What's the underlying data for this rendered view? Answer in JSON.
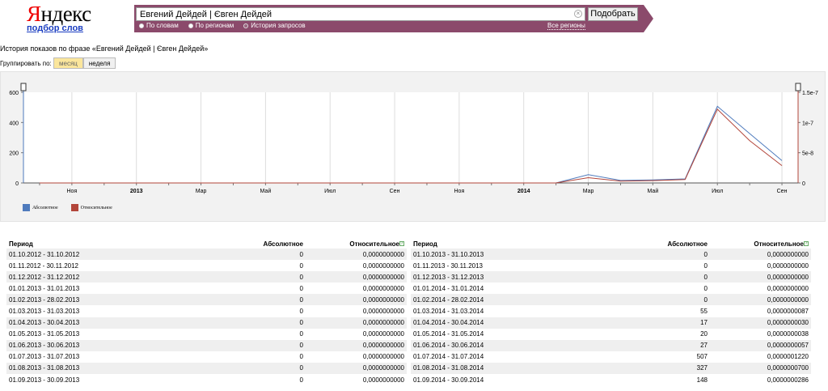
{
  "header": {
    "logo_first": "Я",
    "logo_rest": "ндекс",
    "sublink": "подбор слов",
    "query": "Евгений Дейдей | Євген Дейдей",
    "submit": "Подобрать",
    "radios": [
      {
        "label": "По словам",
        "checked": false
      },
      {
        "label": "По регионам",
        "checked": false
      },
      {
        "label": "История запросов",
        "checked": true
      }
    ],
    "regions": "Все регионы"
  },
  "page": {
    "title": "История показов по фразе «Евгений Дейдей | Євген Дейдей»",
    "group_label": "Группировать по:",
    "group_tabs": [
      {
        "label": "месяц",
        "active": true
      },
      {
        "label": "неделя",
        "active": false
      }
    ]
  },
  "colors": {
    "absolute": "#4f7bbd",
    "relative": "#b2453a",
    "header": "#8b4a6b"
  },
  "chart_data": {
    "type": "line",
    "x": [
      "10.2012",
      "11.2012",
      "12.2012",
      "01.2013",
      "02.2013",
      "03.2013",
      "04.2013",
      "05.2013",
      "06.2013",
      "07.2013",
      "08.2013",
      "09.2013",
      "10.2013",
      "11.2013",
      "12.2013",
      "01.2014",
      "02.2014",
      "03.2014",
      "04.2014",
      "05.2014",
      "06.2014",
      "07.2014",
      "08.2014",
      "09.2014"
    ],
    "x_tick_labels": [
      "Ноя",
      "2013",
      "Мар",
      "Май",
      "Июл",
      "Сен",
      "Ноя",
      "2014",
      "Мар",
      "Май",
      "Июл",
      "Сен"
    ],
    "y_ticks_left": [
      "600",
      "400",
      "200",
      "0"
    ],
    "y_ticks_right": [
      "1.5e-7",
      "1e-7",
      "5e-8",
      "0"
    ],
    "ylim_left": [
      0,
      600
    ],
    "ylim_right": [
      0,
      1.5e-07
    ],
    "grid": true,
    "legend_position": "bottom-left",
    "series": [
      {
        "name": "Абсолютное",
        "axis": "left",
        "values": [
          0,
          0,
          0,
          0,
          0,
          0,
          0,
          0,
          0,
          0,
          0,
          0,
          0,
          0,
          0,
          0,
          0,
          55,
          17,
          20,
          27,
          507,
          327,
          148
        ]
      },
      {
        "name": "Относительное",
        "axis": "right",
        "values": [
          0,
          0,
          0,
          0,
          0,
          0,
          0,
          0,
          0,
          0,
          0,
          0,
          0,
          0,
          0,
          0,
          0,
          8.7e-09,
          3e-09,
          3.8e-09,
          5.7e-09,
          1.22e-07,
          7e-08,
          2.86e-08
        ]
      }
    ]
  },
  "table": {
    "headers": {
      "period": "Период",
      "absolute": "Абсолютное",
      "relative": "Относительное",
      "help": "?"
    },
    "left": [
      [
        "01.10.2012 - 31.10.2012",
        "0",
        "0,0000000000"
      ],
      [
        "01.11.2012 - 30.11.2012",
        "0",
        "0,0000000000"
      ],
      [
        "01.12.2012 - 31.12.2012",
        "0",
        "0,0000000000"
      ],
      [
        "01.01.2013 - 31.01.2013",
        "0",
        "0,0000000000"
      ],
      [
        "01.02.2013 - 28.02.2013",
        "0",
        "0,0000000000"
      ],
      [
        "01.03.2013 - 31.03.2013",
        "0",
        "0,0000000000"
      ],
      [
        "01.04.2013 - 30.04.2013",
        "0",
        "0,0000000000"
      ],
      [
        "01.05.2013 - 31.05.2013",
        "0",
        "0,0000000000"
      ],
      [
        "01.06.2013 - 30.06.2013",
        "0",
        "0,0000000000"
      ],
      [
        "01.07.2013 - 31.07.2013",
        "0",
        "0,0000000000"
      ],
      [
        "01.08.2013 - 31.08.2013",
        "0",
        "0,0000000000"
      ],
      [
        "01.09.2013 - 30.09.2013",
        "0",
        "0,0000000000"
      ]
    ],
    "right": [
      [
        "01.10.2013 - 31.10.2013",
        "0",
        "0,0000000000"
      ],
      [
        "01.11.2013 - 30.11.2013",
        "0",
        "0,0000000000"
      ],
      [
        "01.12.2013 - 31.12.2013",
        "0",
        "0,0000000000"
      ],
      [
        "01.01.2014 - 31.01.2014",
        "0",
        "0,0000000000"
      ],
      [
        "01.02.2014 - 28.02.2014",
        "0",
        "0,0000000000"
      ],
      [
        "01.03.2014 - 31.03.2014",
        "55",
        "0,0000000087"
      ],
      [
        "01.04.2014 - 30.04.2014",
        "17",
        "0,0000000030"
      ],
      [
        "01.05.2014 - 31.05.2014",
        "20",
        "0,0000000038"
      ],
      [
        "01.06.2014 - 30.06.2014",
        "27",
        "0,0000000057"
      ],
      [
        "01.07.2014 - 31.07.2014",
        "507",
        "0,0000001220"
      ],
      [
        "01.08.2014 - 31.08.2014",
        "327",
        "0,0000000700"
      ],
      [
        "01.09.2014 - 30.09.2014",
        "148",
        "0,0000000286"
      ]
    ]
  }
}
